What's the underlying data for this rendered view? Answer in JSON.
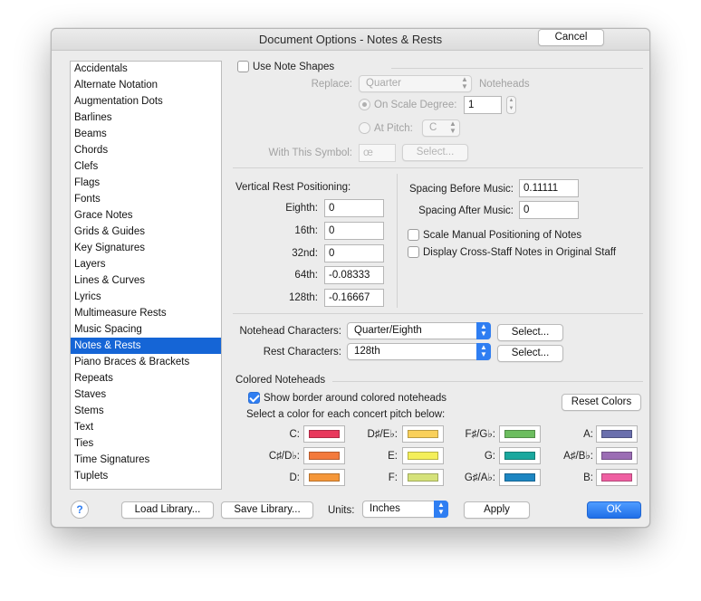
{
  "window": {
    "title": "Document Options - Notes & Rests"
  },
  "sidebar": {
    "items": [
      "Accidentals",
      "Alternate Notation",
      "Augmentation Dots",
      "Barlines",
      "Beams",
      "Chords",
      "Clefs",
      "Flags",
      "Fonts",
      "Grace Notes",
      "Grids & Guides",
      "Key Signatures",
      "Layers",
      "Lines & Curves",
      "Lyrics",
      "Multimeasure Rests",
      "Music Spacing",
      "Notes & Rests",
      "Piano Braces & Brackets",
      "Repeats",
      "Staves",
      "Stems",
      "Text",
      "Ties",
      "Time Signatures",
      "Tuplets"
    ],
    "selected": "Notes & Rests"
  },
  "note_shapes": {
    "use_label": "Use Note Shapes",
    "use_checked": false,
    "replace_label": "Replace:",
    "replace_value": "Quarter",
    "noteheads_label": "Noteheads",
    "scale_degree_label": "On Scale Degree:",
    "scale_degree_value": "1",
    "at_pitch_label": "At Pitch:",
    "at_pitch_value": "C",
    "symbol_label": "With This Symbol:",
    "symbol_value": "œ",
    "select_label": "Select..."
  },
  "rest_positioning": {
    "title": "Vertical Rest Positioning:",
    "rows": [
      {
        "label": "Eighth:",
        "value": "0"
      },
      {
        "label": "16th:",
        "value": "0"
      },
      {
        "label": "32nd:",
        "value": "0"
      },
      {
        "label": "64th:",
        "value": "-0.08333"
      },
      {
        "label": "128th:",
        "value": "-0.16667"
      }
    ]
  },
  "spacing": {
    "before_label": "Spacing Before Music:",
    "before_value": "0.11111",
    "after_label": "Spacing After Music:",
    "after_value": "0",
    "scale_manual_label": "Scale Manual Positioning of Notes",
    "scale_manual_checked": false,
    "cross_staff_label": "Display Cross-Staff Notes in Original Staff",
    "cross_staff_checked": false
  },
  "characters": {
    "notehead_label": "Notehead Characters:",
    "notehead_value": "Quarter/Eighth",
    "rest_label": "Rest Characters:",
    "rest_value": "128th",
    "select_label": "Select..."
  },
  "colored_noteheads": {
    "title": "Colored Noteheads",
    "show_border_label": "Show border around colored noteheads",
    "show_border_checked": true,
    "reset_label": "Reset Colors",
    "instruction": "Select a color for each concert pitch below:",
    "pitches": [
      {
        "label": "C:",
        "color": "#e8385c"
      },
      {
        "label": "C♯/D♭:",
        "color": "#f37a3c"
      },
      {
        "label": "D:",
        "color": "#f5973a"
      },
      {
        "label": "D♯/E♭:",
        "color": "#f9d05a"
      },
      {
        "label": "E:",
        "color": "#f4ef5a"
      },
      {
        "label": "F:",
        "color": "#d5e27a"
      },
      {
        "label": "F♯/G♭:",
        "color": "#6cbd5f"
      },
      {
        "label": "G:",
        "color": "#1aa89e"
      },
      {
        "label": "G♯/A♭:",
        "color": "#1d86c2"
      },
      {
        "label": "A:",
        "color": "#6a6fad"
      },
      {
        "label": "A♯/B♭:",
        "color": "#9b6db4"
      },
      {
        "label": "B:",
        "color": "#ef5fa2"
      }
    ]
  },
  "footer": {
    "help_label": "?",
    "load_label": "Load Library...",
    "save_label": "Save Library...",
    "units_label": "Units:",
    "units_value": "Inches",
    "apply_label": "Apply",
    "cancel_label": "Cancel",
    "ok_label": "OK"
  }
}
